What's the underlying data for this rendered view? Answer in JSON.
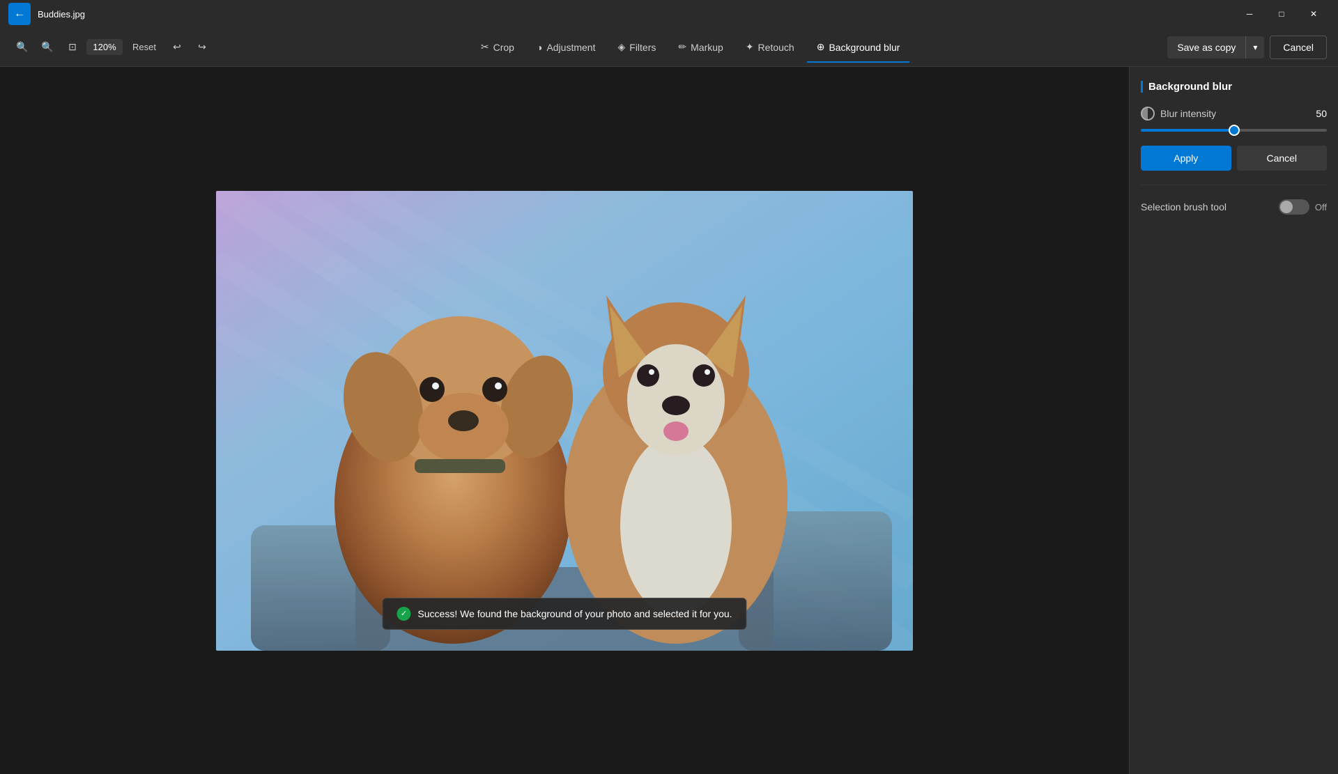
{
  "titlebar": {
    "filename": "Buddies.jpg",
    "back_icon": "←",
    "minimize_label": "─",
    "maximize_label": "□",
    "close_label": "✕"
  },
  "toolbar": {
    "zoom_value": "120%",
    "reset_label": "Reset",
    "undo_icon": "↩",
    "redo_icon": "↪",
    "zoom_in_icon": "+",
    "zoom_out_icon": "−",
    "frame_icon": "⊡",
    "tools": [
      {
        "id": "crop",
        "label": "Crop",
        "icon": "✂"
      },
      {
        "id": "adjustment",
        "label": "Adjustment",
        "icon": "◑"
      },
      {
        "id": "filters",
        "label": "Filters",
        "icon": "◈"
      },
      {
        "id": "markup",
        "label": "Markup",
        "icon": "✏"
      },
      {
        "id": "retouch",
        "label": "Retouch",
        "icon": "✦"
      },
      {
        "id": "background-blur",
        "label": "Background blur",
        "icon": "⊕"
      }
    ],
    "save_as_copy_label": "Save as copy",
    "dropdown_arrow": "▾",
    "cancel_label": "Cancel"
  },
  "right_panel": {
    "section_title": "Background blur",
    "blur_intensity_label": "Blur intensity",
    "blur_intensity_value": "50",
    "slider_percent": 50,
    "apply_label": "Apply",
    "cancel_label": "Cancel",
    "selection_brush_label": "Selection brush tool",
    "toggle_state": "Off"
  },
  "toast": {
    "message": "Success! We found the background of your photo and selected it for you.",
    "check_icon": "✓"
  },
  "colors": {
    "accent": "#0078d4",
    "active_underline": "#0078d4",
    "bg_dark": "#1e1e1e",
    "bg_panel": "#2b2b2b",
    "bg_toolbar": "#2b2b2b",
    "titlebar_back_btn": "#0078d4"
  }
}
